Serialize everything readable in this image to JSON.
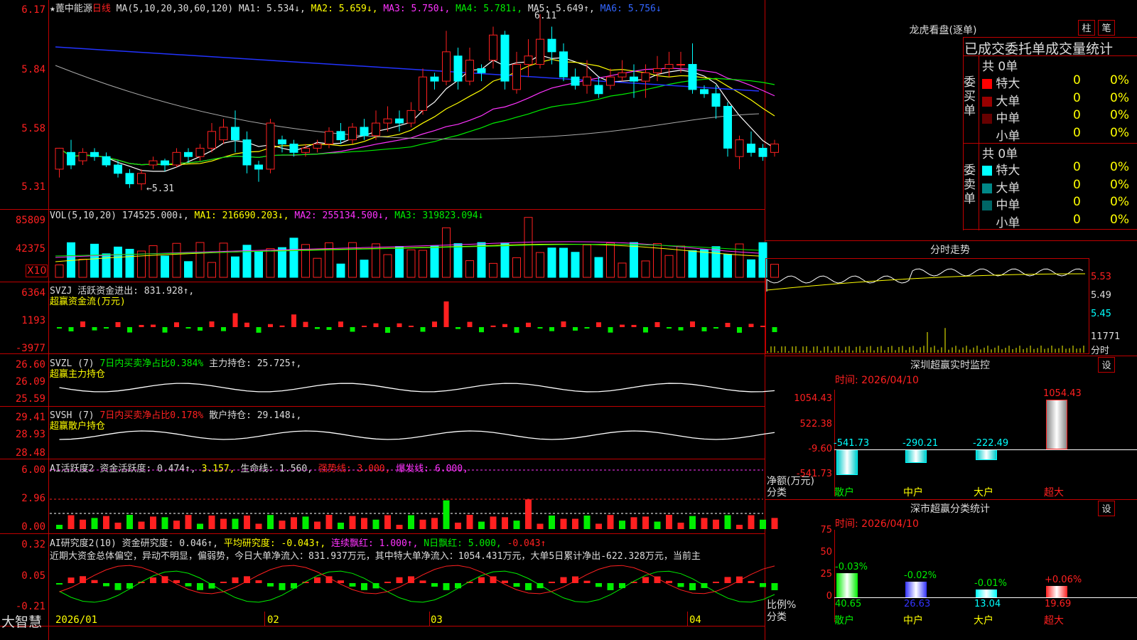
{
  "app": {
    "brand": "大智慧",
    "stock_name": "★蓖中能源",
    "period": "日线"
  },
  "main": {
    "ma_info": [
      {
        "t": "MA(5,10,20,30,60,120)",
        "c": "w"
      },
      {
        "t": "MA1: 5.534↓,",
        "c": "w"
      },
      {
        "t": "MA2: 5.659↓,",
        "c": "y"
      },
      {
        "t": "MA3: 5.750↓,",
        "c": "m"
      },
      {
        "t": "MA4: 5.781↓,",
        "c": "g"
      },
      {
        "t": "MA5: 5.649↑,",
        "c": "w"
      },
      {
        "t": "MA6: 5.756↓",
        "c": "b"
      }
    ],
    "y_labels": [
      "6.17",
      "5.84",
      "5.58",
      "5.31"
    ],
    "high_note": "6.11",
    "low_note": "←5.31"
  },
  "vol": {
    "info": [
      {
        "t": "VOL(5,10,20)",
        "c": "w"
      },
      {
        "t": "174525.000↓,",
        "c": "w"
      },
      {
        "t": "MA1: 216690.203↓,",
        "c": "y"
      },
      {
        "t": "MA2: 255134.500↓,",
        "c": "m"
      },
      {
        "t": "MA3: 319823.094↓",
        "c": "g"
      }
    ],
    "y_labels": [
      "85809",
      "42375"
    ],
    "unit": "X10"
  },
  "svzj": {
    "info1": "SVZJ  活跃资金进出: 831.928↑,",
    "info2": "超赢资金流(万元)",
    "y_labels": [
      "6364",
      "1193",
      "-3977"
    ]
  },
  "svzl": {
    "info": [
      {
        "t": "SVZL (7)",
        "c": "w"
      },
      {
        "t": "7日内买卖净占比0.384%",
        "c": "g"
      },
      {
        "t": "主力持仓: 25.725↑,",
        "c": "w"
      }
    ],
    "info2": "超赢主力持仓",
    "y_labels": [
      "26.60",
      "26.09",
      "25.59"
    ]
  },
  "svsh": {
    "info": [
      {
        "t": "SVSH (7)",
        "c": "w"
      },
      {
        "t": "7日内买卖净占比0.178%",
        "c": "r"
      },
      {
        "t": "散户持仓: 29.148↓,",
        "c": "w"
      }
    ],
    "info2": "超赢散户持仓",
    "y_labels": [
      "29.41",
      "28.93",
      "28.48"
    ]
  },
  "ai_active": {
    "info": [
      {
        "t": "AI活跃度2",
        "c": "w"
      },
      {
        "t": "资金活跃度: 0.474↑,",
        "c": "w"
      },
      {
        "t": "3.157,",
        "c": "y"
      },
      {
        "t": "生命线: 1.560,",
        "c": "w"
      },
      {
        "t": "强势线: 3.000,",
        "c": "r"
      },
      {
        "t": "爆发线: 6.000,",
        "c": "m"
      }
    ],
    "y_labels": [
      "6.00",
      "2.96",
      "0.00"
    ]
  },
  "ai_research": {
    "info": [
      {
        "t": "AI研究度2(10)",
        "c": "w"
      },
      {
        "t": "资金研究度: 0.046↑,",
        "c": "w"
      },
      {
        "t": "平均研究度: -0.043↑,",
        "c": "y"
      },
      {
        "t": "连续飘红: 1.000↑,",
        "c": "m"
      },
      {
        "t": "N日飘红: 5.000,",
        "c": "g"
      },
      {
        "t": "-0.043↑",
        "c": "r"
      }
    ],
    "desc": "近期大资金总体偏空，异动不明显，偏弱势，今日大单净流入：831.937万元，其中特大单净流入：1054.431万元，大单5日累计净出-622.328万元，当前主",
    "y_labels": [
      "0.32",
      "0.05",
      "-0.21"
    ]
  },
  "x_axis": [
    "2026/01",
    "02",
    "03",
    "04"
  ],
  "right": {
    "lhb_title": "龙虎看盘(逐单)",
    "btn_zhu": "柱",
    "btn_bi": "笔",
    "tbl_title": "已成交委托单成交量统计",
    "buy_label": "委买单",
    "sell_label": "委卖单",
    "buy_total": "共 0单",
    "sell_total": "共 0单",
    "buy_rows": [
      {
        "name": "特大",
        "v": "0",
        "p": "0%",
        "color": "#ff0000"
      },
      {
        "name": "大单",
        "v": "0",
        "p": "0%",
        "color": "#990000"
      },
      {
        "name": "中单",
        "v": "0",
        "p": "0%",
        "color": "#660000"
      },
      {
        "name": "小单",
        "v": "0",
        "p": "0%",
        "color": "#000000"
      }
    ],
    "sell_rows": [
      {
        "name": "特大",
        "v": "0",
        "p": "0%",
        "color": "#00ffff"
      },
      {
        "name": "大单",
        "v": "0",
        "p": "0%",
        "color": "#008888"
      },
      {
        "name": "中单",
        "v": "0",
        "p": "0%",
        "color": "#006666"
      },
      {
        "name": "小单",
        "v": "0",
        "p": "0%",
        "color": "#000000"
      }
    ],
    "intraday_title": "分时走势",
    "intraday_y": [
      "5.53",
      "5.49",
      "5.45",
      "11771",
      "分时"
    ],
    "monitor_title": "深圳超赢实时监控",
    "set_btn": "设",
    "monitor_time": "时间: 2026/04/10",
    "monitor_y": [
      "1054.43",
      "522.38",
      "-9.60",
      "-541.73"
    ],
    "monitor_left": [
      "净额(万元)",
      "分类"
    ],
    "monitor_cats": [
      "散户",
      "中户",
      "大户",
      "超大"
    ],
    "monitor_vals": [
      "-541.73",
      "-290.21",
      "-222.49",
      "1054.43"
    ],
    "class_title": "深市超赢分类统计",
    "class_time": "时间: 2026/04/10",
    "class_y": [
      "75",
      "50",
      "25",
      "0"
    ],
    "class_left": [
      "比例%",
      "分类"
    ],
    "class_cats": [
      "散户",
      "中户",
      "大户",
      "超大"
    ],
    "class_pct": [
      "-0.03%",
      "-0.02%",
      "-0.01%",
      "+0.06%"
    ],
    "class_vals": [
      "40.65",
      "26.63",
      "13.04",
      "19.69"
    ]
  },
  "chart_data": {
    "type": "candlestick",
    "y_range": [
      5.25,
      6.2
    ],
    "candles": [
      [
        5.42,
        5.52,
        5.38,
        5.5
      ],
      [
        5.5,
        5.44,
        5.42,
        5.56
      ],
      [
        5.46,
        5.5,
        5.44,
        5.52
      ],
      [
        5.5,
        5.48,
        5.46,
        5.52
      ],
      [
        5.48,
        5.44,
        5.43,
        5.5
      ],
      [
        5.44,
        5.4,
        5.38,
        5.46
      ],
      [
        5.4,
        5.35,
        5.33,
        5.42
      ],
      [
        5.35,
        5.4,
        5.32,
        5.42
      ],
      [
        5.44,
        5.46,
        5.42,
        5.48
      ],
      [
        5.46,
        5.44,
        5.41,
        5.47
      ],
      [
        5.44,
        5.5,
        5.43,
        5.52
      ],
      [
        5.5,
        5.48,
        5.45,
        5.52
      ],
      [
        5.48,
        5.52,
        5.46,
        5.54
      ],
      [
        5.52,
        5.6,
        5.5,
        5.64
      ],
      [
        5.56,
        5.62,
        5.54,
        5.66
      ],
      [
        5.62,
        5.56,
        5.5,
        5.7
      ],
      [
        5.56,
        5.44,
        5.4,
        5.6
      ],
      [
        5.44,
        5.42,
        5.36,
        5.46
      ],
      [
        5.42,
        5.64,
        5.4,
        5.66
      ],
      [
        5.56,
        5.54,
        5.5,
        5.58
      ],
      [
        5.54,
        5.5,
        5.48,
        5.56
      ],
      [
        5.5,
        5.52,
        5.48,
        5.54
      ],
      [
        5.52,
        5.54,
        5.5,
        5.56
      ],
      [
        5.54,
        5.6,
        5.52,
        5.62
      ],
      [
        5.6,
        5.56,
        5.54,
        5.64
      ],
      [
        5.56,
        5.62,
        5.54,
        5.64
      ],
      [
        5.62,
        5.58,
        5.56,
        5.66
      ],
      [
        5.58,
        5.64,
        5.56,
        5.7
      ],
      [
        5.64,
        5.66,
        5.6,
        5.72
      ],
      [
        5.66,
        5.64,
        5.6,
        5.7
      ],
      [
        5.64,
        5.7,
        5.62,
        5.74
      ],
      [
        5.7,
        5.86,
        5.68,
        5.9
      ],
      [
        5.86,
        5.84,
        5.8,
        5.88
      ],
      [
        5.84,
        5.98,
        5.82,
        6.08
      ],
      [
        5.96,
        5.84,
        5.8,
        6.0
      ],
      [
        5.84,
        5.94,
        5.82,
        6.0
      ],
      [
        5.9,
        5.88,
        5.84,
        5.92
      ],
      [
        5.94,
        6.06,
        5.9,
        6.1
      ],
      [
        6.06,
        5.84,
        5.8,
        6.08
      ],
      [
        5.8,
        5.92,
        5.78,
        5.98
      ],
      [
        5.92,
        5.96,
        5.86,
        6.04
      ],
      [
        5.92,
        6.04,
        5.9,
        6.16
      ],
      [
        6.04,
        5.98,
        5.92,
        6.1
      ],
      [
        5.98,
        5.86,
        5.84,
        6.02
      ],
      [
        5.86,
        5.82,
        5.8,
        5.9
      ],
      [
        5.82,
        5.86,
        5.78,
        5.94
      ],
      [
        5.82,
        5.78,
        5.76,
        5.86
      ],
      [
        5.82,
        5.86,
        5.8,
        5.9
      ],
      [
        5.86,
        5.88,
        5.84,
        5.94
      ],
      [
        5.86,
        5.84,
        5.76,
        5.92
      ],
      [
        5.84,
        5.88,
        5.76,
        5.92
      ],
      [
        5.88,
        5.9,
        5.84,
        5.96
      ],
      [
        5.9,
        5.92,
        5.86,
        5.98
      ],
      [
        5.92,
        5.92,
        5.88,
        5.98
      ],
      [
        5.92,
        5.8,
        5.78,
        6.02
      ],
      [
        5.8,
        5.78,
        5.76,
        5.82
      ],
      [
        5.78,
        5.72,
        5.66,
        5.82
      ],
      [
        5.72,
        5.52,
        5.48,
        5.74
      ],
      [
        5.48,
        5.56,
        5.42,
        5.58
      ],
      [
        5.54,
        5.5,
        5.48,
        5.6
      ],
      [
        5.52,
        5.48,
        5.46,
        5.54
      ],
      [
        5.5,
        5.54,
        5.48,
        5.56
      ]
    ]
  }
}
